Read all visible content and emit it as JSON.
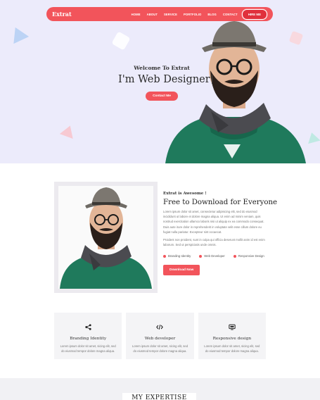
{
  "nav": {
    "logo": "Extrat",
    "menu": [
      "HOME",
      "ABOUT",
      "SERVICE",
      "PORTFOLIO",
      "BLOG",
      "CONTACT"
    ],
    "hire_label": "HIRE ME"
  },
  "hero": {
    "subtitle": "Welcome To Extrat",
    "title": "I'm Web Designer",
    "button": "Contact Me"
  },
  "about": {
    "tag": "Extrat is Awesome !",
    "title": "Free to Download for Everyone",
    "paragraph1": "Lorem ipsum dolor sit amet, consectetur adipisicing elit, sed do eiusmod incididunt ut labore et dolore magna aliqua. Ut enim ad minim veniam, quis nostrud exercitation ullamco laboris nisi ut aliquip ex ea commodo consequat. Duis aute irure dolor in reprehenderit in voluptate velit esse cillum dolore eu fugiat nulla pariatur. Excepteur sint occaecat.",
    "paragraph2": "Proident non proident, sunt in culpa qui officia deserunt mollit anim id est enim laborum. Sed ut perspiciatis unde omnis.",
    "skills": [
      "Branding Identity",
      "Web Developer",
      "Responsive Design"
    ],
    "button": "Download Now"
  },
  "services": [
    {
      "icon": "share-icon",
      "title": "Branding Identity",
      "desc": "Lorem ipsum dolor sit amet, sicing elit, sed do eiusmod tempor dolore magna aliqua."
    },
    {
      "icon": "code-icon",
      "title": "Web developer",
      "desc": "Lorem ipsum dolor sit amet, sicing elit, sed do eiusmod tempor dolore magna aliqua."
    },
    {
      "icon": "monitor-icon",
      "title": "Responsive design",
      "desc": "Lorem ipsum dolor sit amet, sicing elit, sed do eiusmod tempor dolore magna aliqua."
    }
  ],
  "section": {
    "expertise_title": "MY EXPERTISE"
  },
  "colors": {
    "accent": "#f2545b",
    "hero_bg": "#ecebfb"
  }
}
